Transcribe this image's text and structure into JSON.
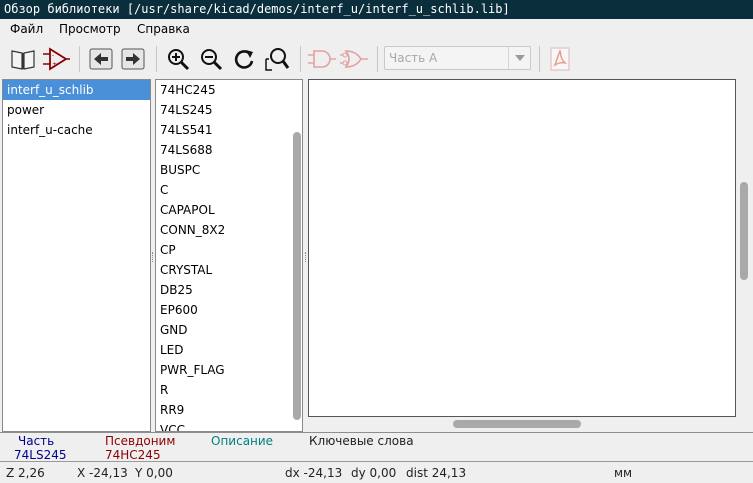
{
  "window": {
    "title": "Обзор библиотеки [/usr/share/kicad/demos/interf_u/interf_u_schlib.lib]"
  },
  "menu": [
    "Файл",
    "Просмотр",
    "Справка"
  ],
  "toolbar": {
    "icons": [
      "library-browser-icon",
      "component-icon",
      "previous-icon",
      "next-icon",
      "zoom-in-icon",
      "zoom-out-icon",
      "redraw-icon",
      "zoom-fit-icon",
      "demorgan-normal-icon",
      "demorgan-convert-icon",
      "part-select",
      "pdf-datasheet-icon"
    ],
    "part_select": {
      "placeholder": "Часть А"
    }
  },
  "libraries": {
    "items": [
      "interf_u_schlib",
      "power",
      "interf_u-cache"
    ],
    "selected_index": 0
  },
  "components": {
    "items": [
      "74HC245",
      "74LS245",
      "74LS541",
      "74LS688",
      "BUSPC",
      "C",
      "CAPAPOL",
      "CONN_8X2",
      "CP",
      "CRYSTAL",
      "DB25",
      "EP600",
      "GND",
      "LED",
      "PWR_FLAG",
      "R",
      "RR9",
      "VCC"
    ]
  },
  "info": {
    "part_label": "Часть",
    "part_value": "74LS245",
    "alias_label": "Псевдоним",
    "alias_value": "74HC245",
    "description_label": "Описание",
    "keywords_label": "Ключевые слова"
  },
  "status": {
    "zoom": "Z 2,26",
    "x": "X -24,13",
    "y": "Y 0,00",
    "dx": "dx -24,13",
    "dy": "dy 0,00",
    "dist": "dist 24,13",
    "units": "мм"
  },
  "colors": {
    "title_bg": "#0b2e3c",
    "selection": "#4a90d9",
    "part_color": "#00008b",
    "alias_color": "#8b0000",
    "description_color": "#008080"
  }
}
